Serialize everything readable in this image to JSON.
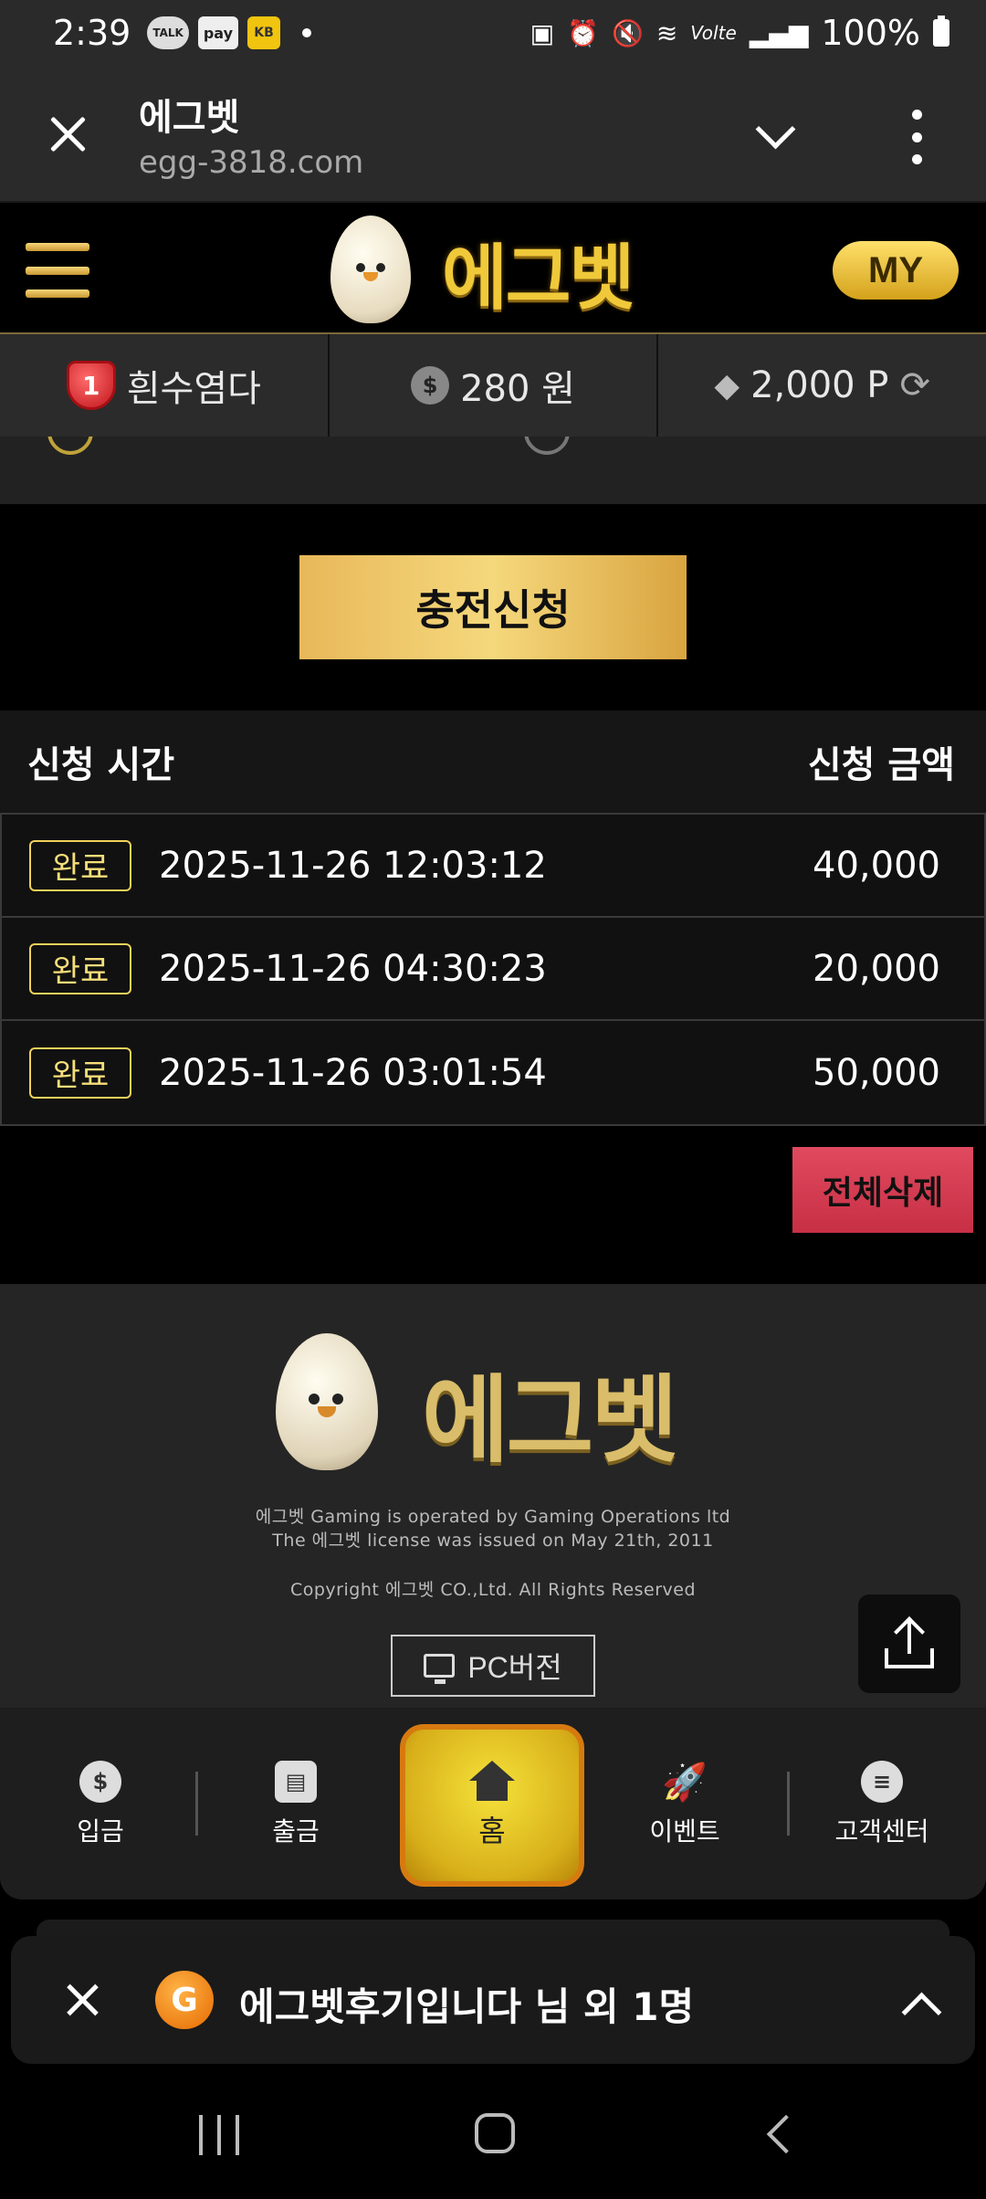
{
  "status_bar": {
    "time": "2:39",
    "chips": [
      "TALK",
      "pay",
      "KB"
    ],
    "battery": "100%",
    "network": "Volte"
  },
  "browser": {
    "title": "에그벳",
    "url": "egg-3818.com"
  },
  "header": {
    "logo_text": "에그벳",
    "my_label": "MY"
  },
  "user_bar": {
    "level": "1",
    "nickname": "흰수염다",
    "money": "280 원",
    "coin_symbol": "$",
    "points": "2,000 P"
  },
  "charge_button": "충전신청",
  "table": {
    "col_time": "신청 시간",
    "col_amount": "신청 금액",
    "rows": [
      {
        "status": "완료",
        "datetime": "2025-11-26 12:03:12",
        "amount": "40,000"
      },
      {
        "status": "완료",
        "datetime": "2025-11-26 04:30:23",
        "amount": "20,000"
      },
      {
        "status": "완료",
        "datetime": "2025-11-26 03:01:54",
        "amount": "50,000"
      }
    ]
  },
  "delete_all": "전체삭제",
  "footer": {
    "logo_text": "에그벳",
    "line1": "에그벳 Gaming is operated by Gaming Operations ltd",
    "line2": "The 에그벳 license was issued on May 21th, 2011",
    "copyright": "Copyright 에그벳 CO.,Ltd. All Rights Reserved",
    "pc_version": "PC버전"
  },
  "bottom_nav": {
    "deposit": "입금",
    "withdraw": "출금",
    "home": "홈",
    "event": "이벤트",
    "support": "고객센터",
    "deposit_glyph": "$"
  },
  "notification": {
    "icon_letter": "G",
    "text": "에그벳후기입니다 님 외 1명"
  },
  "colors": {
    "gold": "#f0c93a",
    "delete_red": "#d83a52",
    "home_yellow": "#e8c41e"
  }
}
